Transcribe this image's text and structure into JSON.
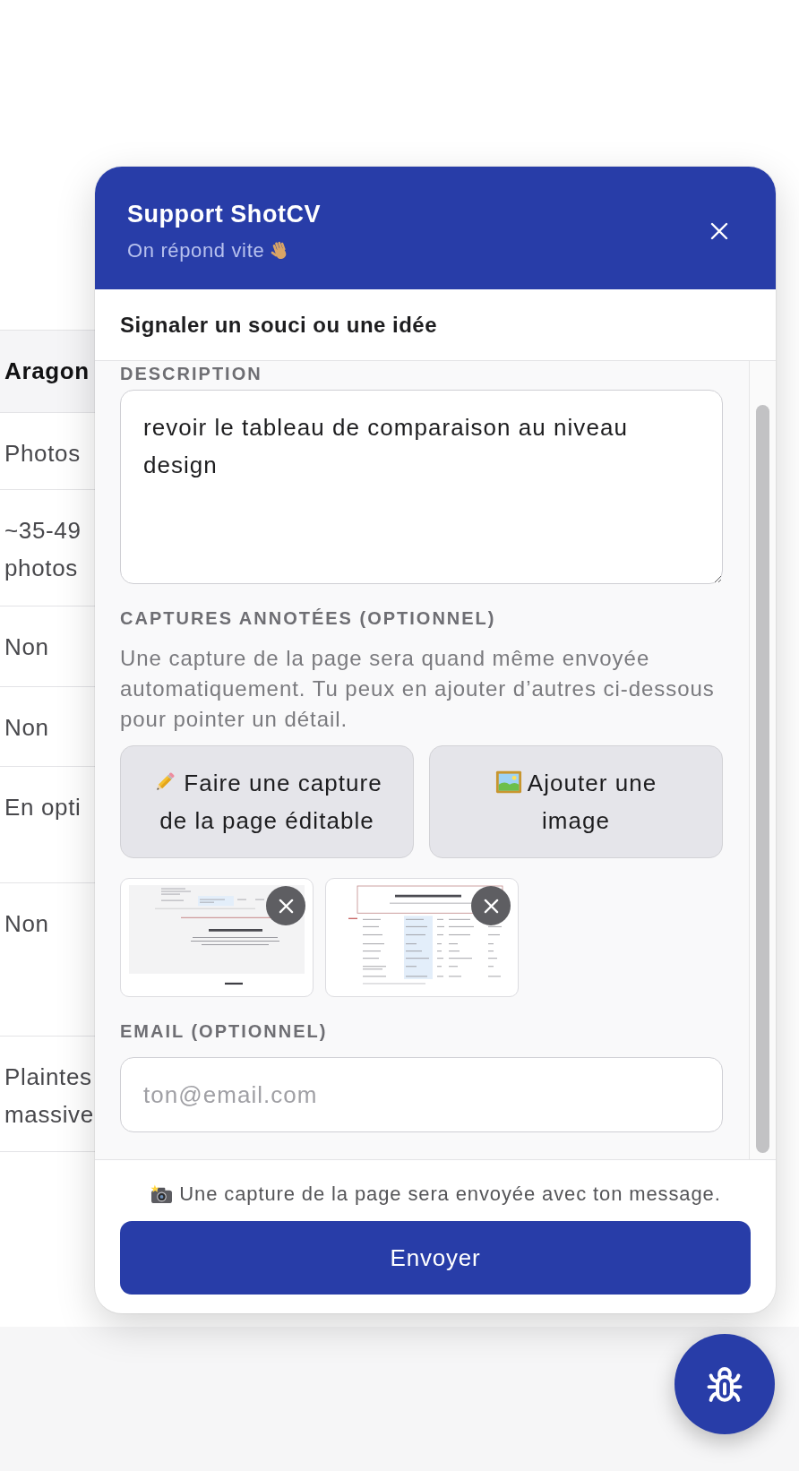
{
  "background_table": {
    "column_1": {
      "header": "Aragon",
      "cells": [
        "Photos",
        "~35-49 photos",
        "Non",
        "Non",
        "En opti",
        "Non",
        "Plaintes massive"
      ]
    }
  },
  "support_widget": {
    "header": {
      "title": "Support ShotCV",
      "subtitle": "On répond vite"
    },
    "form": {
      "title": "Signaler un souci ou une idée",
      "description": {
        "label": "DESCRIPTION",
        "value": "revoir le tableau de comparaison au niveau design"
      },
      "captures": {
        "label": "CAPTURES ANNOTÉES (OPTIONNEL)",
        "help": "Une capture de la page sera quand même envoyée automatiquement. Tu peux en ajouter d’autres ci-dessous pour pointer un détail.",
        "actions": [
          {
            "kind": "capture",
            "label": "Faire une capture de la page éditable"
          },
          {
            "kind": "upload",
            "label": "Ajouter une image"
          }
        ],
        "attachments": [
          {
            "kind": "page_section"
          },
          {
            "kind": "comparison_table"
          }
        ]
      },
      "email": {
        "label": "EMAIL (OPTIONNEL)",
        "placeholder": "ton@email.com"
      }
    },
    "footer": {
      "note": "Une capture de la page sera envoyée avec ton message.",
      "submit": "Envoyer"
    }
  }
}
